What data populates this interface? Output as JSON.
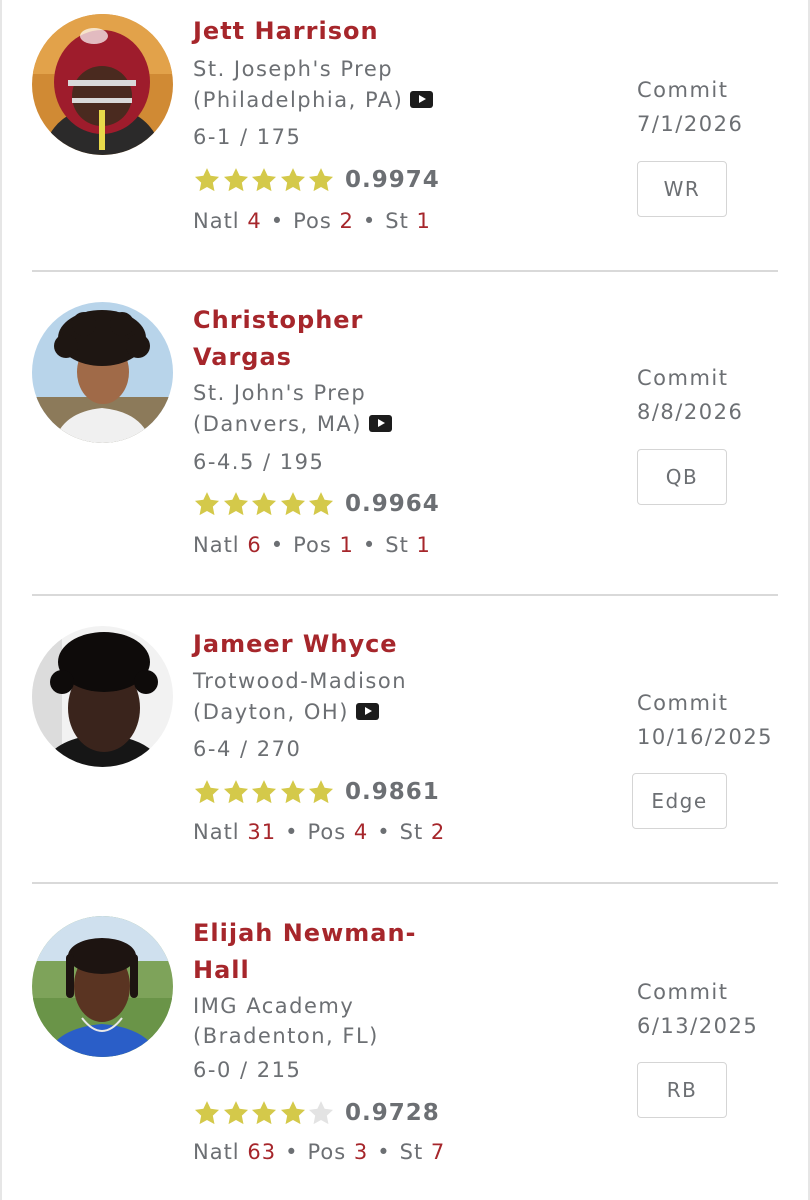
{
  "commit_label": "Commit",
  "players": [
    {
      "name": "Jett Harrison",
      "school": "St. Joseph's Prep",
      "location": "(Philadelphia, PA)",
      "has_video": true,
      "measurements": "6-1 / 175",
      "stars": 5,
      "rating": "0.9974",
      "natl_label": "Natl",
      "natl": "4",
      "pos_label": "Pos",
      "pos_rank": "2",
      "st_label": "St",
      "st": "1",
      "commit_date": "7/1/2026",
      "position": "WR"
    },
    {
      "name": "Christopher Vargas",
      "school": "St. John's Prep",
      "location": "(Danvers, MA)",
      "has_video": true,
      "measurements": "6-4.5 / 195",
      "stars": 5,
      "rating": "0.9964",
      "natl_label": "Natl",
      "natl": "6",
      "pos_label": "Pos",
      "pos_rank": "1",
      "st_label": "St",
      "st": "1",
      "commit_date": "8/8/2026",
      "position": "QB"
    },
    {
      "name": "Jameer Whyce",
      "school": "Trotwood-Madison",
      "location": "(Dayton, OH)",
      "has_video": true,
      "measurements": "6-4 / 270",
      "stars": 5,
      "rating": "0.9861",
      "natl_label": "Natl",
      "natl": "31",
      "pos_label": "Pos",
      "pos_rank": "4",
      "st_label": "St",
      "st": "2",
      "commit_date": "10/16/2025",
      "position": "Edge"
    },
    {
      "name": "Elijah Newman-Hall",
      "school": "IMG Academy",
      "location": "(Bradenton, FL)",
      "has_video": false,
      "measurements": "6-0 / 215",
      "stars": 4,
      "rating": "0.9728",
      "natl_label": "Natl",
      "natl": "63",
      "pos_label": "Pos",
      "pos_rank": "3",
      "st_label": "St",
      "st": "7",
      "commit_date": "6/13/2025",
      "position": "RB"
    }
  ],
  "colors": {
    "accent": "#a6262b",
    "text_muted": "#6c6f73",
    "star_filled": "#d4c94a",
    "star_empty": "#e3e3e3",
    "divider": "#d9d9d9"
  }
}
